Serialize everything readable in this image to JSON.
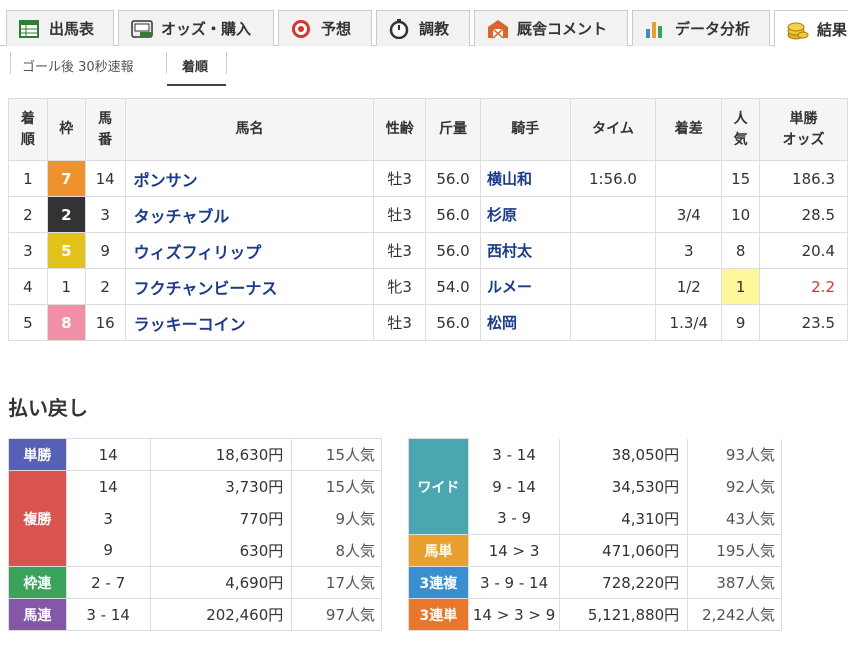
{
  "tabs": [
    {
      "label": "出馬表",
      "icon": "table-icon"
    },
    {
      "label": "オッズ・購入",
      "icon": "ipat-icon"
    },
    {
      "label": "予想",
      "icon": "target-icon"
    },
    {
      "label": "調教",
      "icon": "stopwatch-icon"
    },
    {
      "label": "厩舎コメント",
      "icon": "barn-icon"
    },
    {
      "label": "データ分析",
      "icon": "bar-chart-icon"
    },
    {
      "label": "結果",
      "icon": "coins-icon"
    }
  ],
  "subtabs": [
    "ゴール後 30秒速報",
    "着順"
  ],
  "results": {
    "headers": [
      "着\n順",
      "枠",
      "馬\n番",
      "馬名",
      "性齢",
      "斤量",
      "騎手",
      "タイム",
      "着差",
      "人\n気",
      "単勝\nオッズ"
    ],
    "rows": [
      {
        "rank": "1",
        "waku": "7",
        "umaban": "14",
        "name": "ポンサン",
        "sexage": "牡3",
        "weight": "56.0",
        "jockey": "横山和",
        "time": "1:56.0",
        "margin": "",
        "pop": "15",
        "odds": "186.3"
      },
      {
        "rank": "2",
        "waku": "2",
        "umaban": "3",
        "name": "タッチャブル",
        "sexage": "牡3",
        "weight": "56.0",
        "jockey": "杉原",
        "time": "",
        "margin": "3/4",
        "pop": "10",
        "odds": "28.5"
      },
      {
        "rank": "3",
        "waku": "5",
        "umaban": "9",
        "name": "ウィズフィリップ",
        "sexage": "牡3",
        "weight": "56.0",
        "jockey": "西村太",
        "time": "",
        "margin": "3",
        "pop": "8",
        "odds": "20.4"
      },
      {
        "rank": "4",
        "waku": "1",
        "umaban": "2",
        "name": "フクチャンビーナス",
        "sexage": "牝3",
        "weight": "54.0",
        "jockey": "ルメー",
        "time": "",
        "margin": "1/2",
        "pop": "1",
        "odds": "2.2"
      },
      {
        "rank": "5",
        "waku": "8",
        "umaban": "16",
        "name": "ラッキーコイン",
        "sexage": "牡3",
        "weight": "56.0",
        "jockey": "松岡",
        "time": "",
        "margin": "1.3/4",
        "pop": "9",
        "odds": "23.5"
      }
    ]
  },
  "payout_title": "払い戻し",
  "payout_left": [
    {
      "label": "単勝",
      "color": "#5560b6",
      "entries": [
        {
          "num": "14",
          "amt": "18,630円",
          "pop": "15人気"
        }
      ]
    },
    {
      "label": "複勝",
      "color": "#d9534f",
      "entries": [
        {
          "num": "14",
          "amt": "3,730円",
          "pop": "15人気"
        },
        {
          "num": "3",
          "amt": "770円",
          "pop": "9人気"
        },
        {
          "num": "9",
          "amt": "630円",
          "pop": "8人気"
        }
      ]
    },
    {
      "label": "枠連",
      "color": "#3aa35a",
      "entries": [
        {
          "num": "2 - 7",
          "amt": "4,690円",
          "pop": "17人気"
        }
      ]
    },
    {
      "label": "馬連",
      "color": "#8458a8",
      "entries": [
        {
          "num": "3 - 14",
          "amt": "202,460円",
          "pop": "97人気"
        }
      ]
    }
  ],
  "payout_right": [
    {
      "label": "ワイド",
      "color": "#4aa6b0",
      "entries": [
        {
          "num": "3 - 14",
          "amt": "38,050円",
          "pop": "93人気"
        },
        {
          "num": "9 - 14",
          "amt": "34,530円",
          "pop": "92人気"
        },
        {
          "num": "3 - 9",
          "amt": "4,310円",
          "pop": "43人気"
        }
      ]
    },
    {
      "label": "馬単",
      "color": "#eaa02f",
      "entries": [
        {
          "num": "14 > 3",
          "amt": "471,060円",
          "pop": "195人気"
        }
      ]
    },
    {
      "label": "3連複",
      "color": "#3a8fd1",
      "entries": [
        {
          "num": "3 - 9 - 14",
          "amt": "728,220円",
          "pop": "387人気"
        }
      ]
    },
    {
      "label": "3連単",
      "color": "#e8762b",
      "entries": [
        {
          "num": "14 > 3 > 9",
          "amt": "5,121,880円",
          "pop": "2,242人気"
        }
      ]
    }
  ],
  "colors": {
    "waku_1": "#ffffff",
    "waku_2": "#333333",
    "waku_5": "#e3c21c",
    "waku_7": "#f0922c",
    "waku_8": "#f08fa6",
    "link": "#1a3a8f",
    "fav_highlight": "#fff59a",
    "fav_odds": "#d9332a"
  }
}
